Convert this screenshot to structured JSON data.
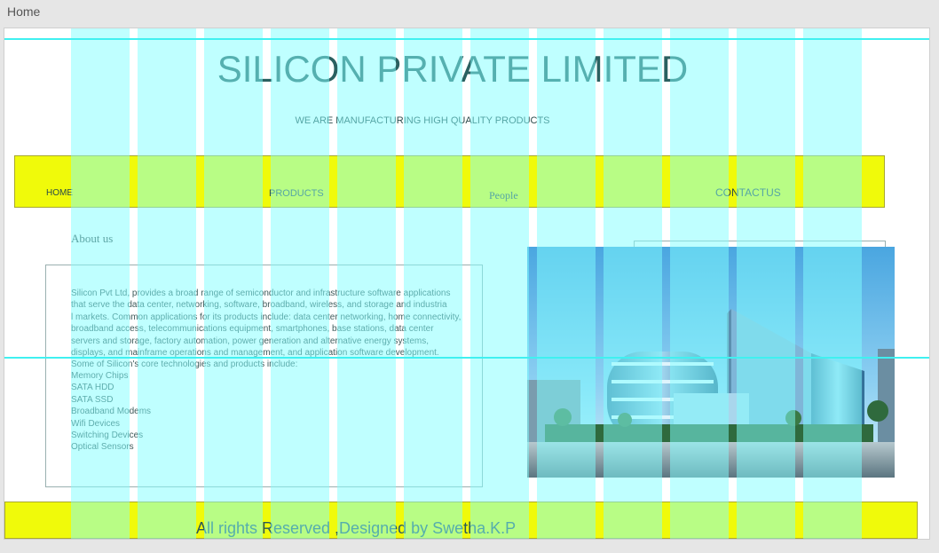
{
  "tab": {
    "label": "Home"
  },
  "header": {
    "title": "SILICON PRIVATE LIMITED",
    "tagline": "WE ARE MANUFACTURING HIGH QUALITY PRODUCTS"
  },
  "nav": {
    "items": [
      "HOME",
      "PRODUCTS",
      "People",
      "CONTACTUS"
    ]
  },
  "about": {
    "heading": "About us",
    "paragraph": " Silicon Pvt Ltd, provides a broad range of semiconductor and infrastructure software applications\n that serve the data center, networking, software, broadband, wireless, and storage and industria\nl markets. Common applications for its products include: data center networking, home connectivity,\nbroadband access, telecommunications equipment, smartphones, base stations, data center\nservers and storage, factory automation, power generation and alternative energy systems,\n displays, and mainframe operations and management, and application software development.\nSome of Silicon's core technologies and products include:",
    "products": [
      "Memory Chips",
      "SATA HDD",
      "SATA SSD",
      "Broadband Modems",
      "Wifi Devices",
      "Switching Devices",
      "Optical Sensors"
    ]
  },
  "image": {
    "subject": "building-photo"
  },
  "footer": {
    "text": "All rights Reserved ,Designed by Swetha.K.P"
  },
  "colors": {
    "accent_yellow": "#f0fa0a",
    "guide_cyan": "#80ffff",
    "title_teal": "#2a6060"
  }
}
